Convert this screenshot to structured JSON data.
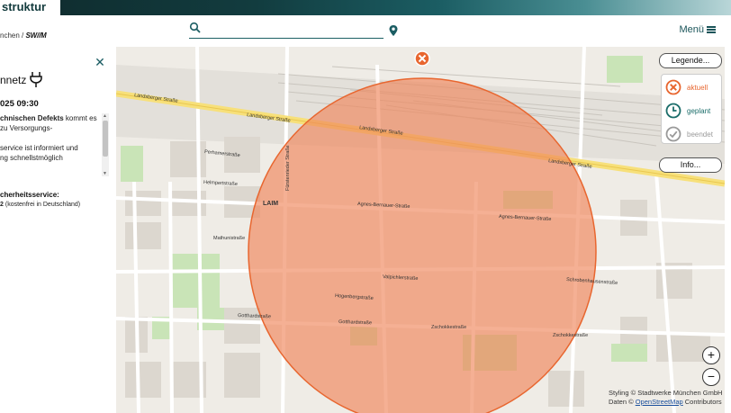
{
  "header": {
    "brand_title": "struktur",
    "breadcrumb_prefix": "nchen /",
    "logo_text": "SW//M"
  },
  "search": {
    "value": "",
    "placeholder": ""
  },
  "menu": {
    "label": "Menü"
  },
  "panel": {
    "title": "nnetz",
    "time": "025 09:30",
    "body_lines": [
      {
        "bold": "chnischen Defekts",
        "rest": " kommt es"
      },
      {
        "bold": "",
        "rest": "zu Versorgungs-"
      },
      {
        "bold": "",
        "rest": ""
      },
      {
        "bold": "",
        "rest": "service ist informiert und"
      },
      {
        "bold": "",
        "rest": "ng schnellstmöglich"
      }
    ],
    "hotline_label": "cherheitsservice:",
    "hotline_number": "2",
    "hotline_note": "(kostenfrei in Deutschland)"
  },
  "legend": {
    "button_label": "Legende...",
    "statuses": [
      {
        "label": "aktuell",
        "color": "#e8662f",
        "icon": "x-circle-icon"
      },
      {
        "label": "geplant",
        "color": "#1b6d6a",
        "icon": "clock-icon"
      },
      {
        "label": "beendet",
        "color": "#9a9a9a",
        "icon": "check-circle-icon"
      }
    ],
    "info_label": "Info..."
  },
  "zoom": {
    "in_label": "+",
    "out_label": "−"
  },
  "attribution": {
    "line1": "Styling © Stadtwerke München GmbH",
    "line2_prefix": "Daten ©",
    "line2_link": "OpenStreetMap",
    "line2_suffix": "Contributors"
  },
  "map": {
    "district_label": "LAIM",
    "street_labels": [
      "Landsberger Straße",
      "Landsberger Straße",
      "Landsberger Straße",
      "Landsberger Straße",
      "Agnes-Bernauer-Straße",
      "Agnes-Bernauer-Straße",
      "Zschokkestraße",
      "Zschokkestraße",
      "Gotthardstraße",
      "Gotthardstraße",
      "Fürstenrieder Straße",
      "Perhamerstraße",
      "Helmpertstraße",
      "Mathunistraße",
      "Valpichlerstraße",
      "Hogenbergstraße",
      "Schrobenhausenstraße"
    ],
    "incident_color": "#f0865a",
    "incident_marker_color": "#e8662f"
  }
}
